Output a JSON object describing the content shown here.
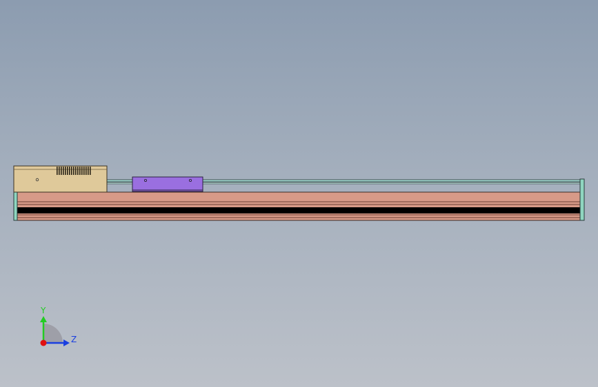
{
  "viewport": {
    "background_top": "#8c9cb0",
    "background_bottom": "#bcc1c9"
  },
  "model": {
    "motor_housing_color": "#dfc99a",
    "carriage_color": "#9a6fe0",
    "rail_body_color": "#d79a88",
    "rail_slot_color": "#000000",
    "guide_rod_color": "#9fd4cc",
    "end_cap_color": "#8fd6c0"
  },
  "triad": {
    "y_label": "Y",
    "z_label": "Z",
    "y_color": "#22cc22",
    "z_color": "#1a3fe0",
    "x_color": "#e01010"
  }
}
